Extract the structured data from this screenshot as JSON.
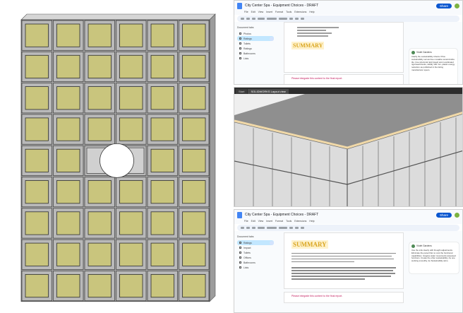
{
  "left_render": {
    "grid": {
      "cols": 6,
      "rows": 9
    },
    "cell_frame_color": "#b9b9b9",
    "cell_panel_color": "#c9c57d",
    "cutout_row": 4,
    "cutout_cols": [
      2,
      3
    ]
  },
  "doc_top": {
    "title": "City Center Spa - Equipment Choices - DRAFT",
    "share_label": "Share",
    "menu": [
      "File",
      "Edit",
      "View",
      "Insert",
      "Format",
      "Tools",
      "Extensions",
      "Help"
    ],
    "outline_header": "Document tabs",
    "outline": [
      {
        "label": "Photos",
        "active": false
      },
      {
        "label": "Ratings",
        "active": true
      },
      {
        "label": "Toilets",
        "active": false
      },
      {
        "label": "Ratings",
        "active": false
      },
      {
        "label": "Bathrooms",
        "active": false
      },
      {
        "label": "Lists",
        "active": false
      }
    ],
    "heading": "SUMMARY",
    "link_text": "Please integrate this content to the final report.",
    "comment_author": "Violet Gardens",
    "comment_text": "Clarify the sustainability criteria. Price sustainability versus free movable ceramic/ultra tile. Use structural rigid (steel) and coordinated rigid lead blocks, ideally 100 mm. plastic energy reduction as published in the listing manufacturer specs."
  },
  "cad": {
    "tabs": [
      "Start",
      "SOLIDWORKS Layout view"
    ],
    "top_color": "#8f8f8f",
    "side_color": "#dcdcdc",
    "edge_strip_color": "#f1d9a8"
  },
  "doc_bottom": {
    "title": "City Center Spa - Equipment Choices - DRAFT",
    "share_label": "Share",
    "menu": [
      "File",
      "Edit",
      "View",
      "Insert",
      "Format",
      "Tools",
      "Extensions",
      "Help"
    ],
    "outline_header": "Document tabs",
    "outline": [
      {
        "label": "Ratings",
        "active": true
      },
      {
        "label": "Impact",
        "active": false
      },
      {
        "label": "Toilets",
        "active": false
      },
      {
        "label": "Offices",
        "active": false
      },
      {
        "label": "Bathrooms",
        "active": false
      },
      {
        "label": "Lists",
        "active": false
      }
    ],
    "heading": "SUMMARY",
    "link_text": "Please integrate this content to the final report.",
    "comment_author": "Violet Gardens",
    "comment_text": "Use the sink clearly with thought adjustments. Eliminate the panel that no cost the functional capabilities. Imagine water movements assessed functions. Create the other sustainability. As one working smoothly, tie Sustainability aims."
  }
}
